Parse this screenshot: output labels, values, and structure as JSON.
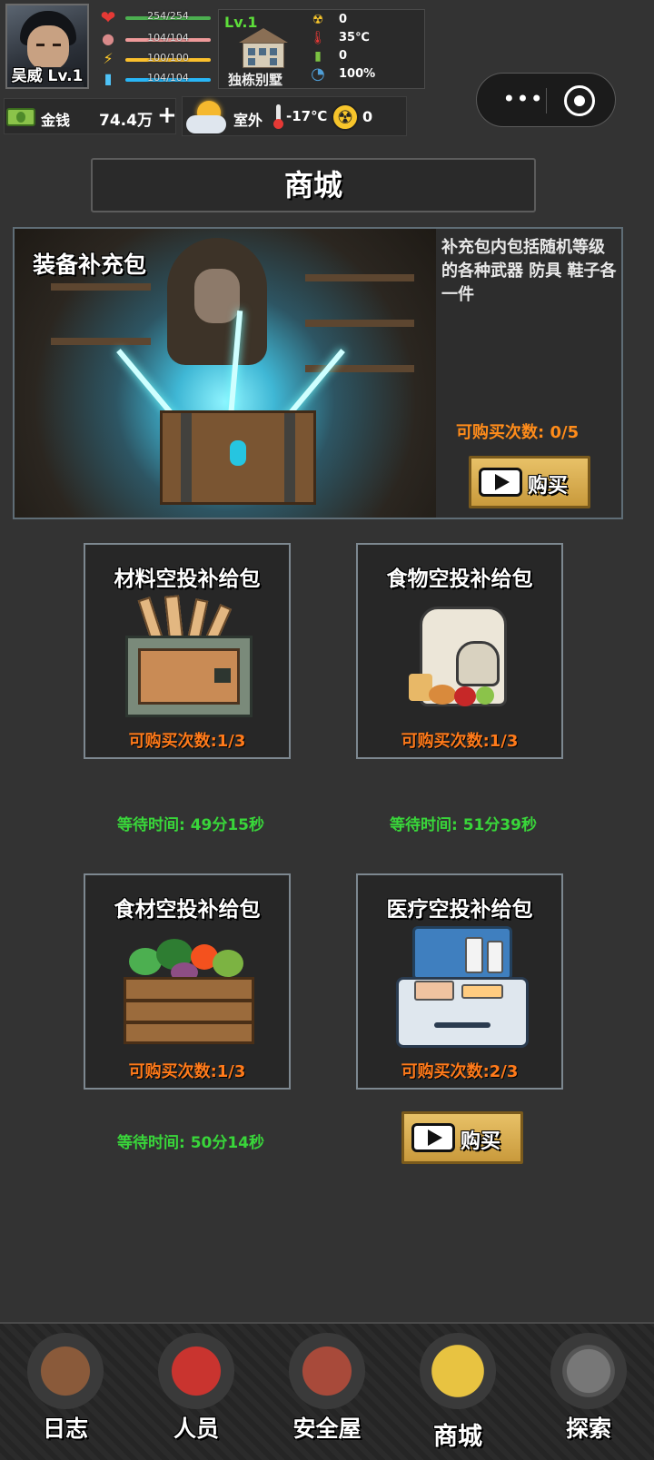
{
  "player": {
    "name_level": "吴威 Lv.1",
    "stats": [
      {
        "icon": "heart-icon",
        "glyph": "❤",
        "value": "254/254",
        "color": "#4caf50",
        "icon_color": "#e53935",
        "fill": 1.0
      },
      {
        "icon": "stomach-icon",
        "glyph": "●",
        "value": "104/104",
        "color": "#ef9a9a",
        "icon_color": "#d98a8a",
        "fill": 1.0
      },
      {
        "icon": "energy-icon",
        "glyph": "⚡",
        "value": "100/100",
        "color": "#fbc02d",
        "icon_color": "#ffca28",
        "fill": 1.0
      },
      {
        "icon": "water-icon",
        "glyph": "▮",
        "value": "104/104",
        "color": "#29b6f6",
        "icon_color": "#4fc3f7",
        "fill": 1.0
      }
    ]
  },
  "shelter": {
    "level": "Lv.1",
    "name": "独栋别墅",
    "stats": [
      {
        "icon": "radiation-icon",
        "glyph": "☢",
        "value": "0",
        "icon_color": "#f7c52b"
      },
      {
        "icon": "thermometer-icon",
        "glyph": "🌡",
        "value": "35℃",
        "icon_color": "#e53935"
      },
      {
        "icon": "battery-icon",
        "glyph": "▮",
        "value": "0",
        "icon_color": "#7cc242"
      },
      {
        "icon": "pie-chart-icon",
        "glyph": "◔",
        "value": "100%",
        "icon_color": "#4f9ed6"
      }
    ]
  },
  "money": {
    "label": "金钱",
    "value": "74.4万",
    "plus": "+"
  },
  "weather": {
    "label": "室外",
    "temperature": "-17℃",
    "radiation": "0"
  },
  "capsule": {
    "more": "•••"
  },
  "page_title": "商城",
  "equipment_pack": {
    "title": "装备补充包",
    "description": "补充包内包括随机等级的各种武器 防具 鞋子各一件",
    "purchase_count": "可购买次数: 0/5",
    "buy_label": "购买"
  },
  "supply_packs": [
    {
      "title": "材料空投补给包",
      "purchase_count": "可购买次数:1/3",
      "wait": "等待时间: 49分15秒"
    },
    {
      "title": "食物空投补给包",
      "purchase_count": "可购买次数:1/3",
      "wait": "等待时间: 51分39秒"
    },
    {
      "title": "食材空投补给包",
      "purchase_count": "可购买次数:1/3",
      "wait": "等待时间: 50分14秒"
    },
    {
      "title": "医疗空投补给包",
      "purchase_count": "可购买次数:2/3",
      "buy_label": "购买"
    }
  ],
  "nav": [
    {
      "label": "日志",
      "icon": "journal-icon"
    },
    {
      "label": "人员",
      "icon": "id-badge-icon"
    },
    {
      "label": "安全屋",
      "icon": "shelter-house-icon"
    },
    {
      "label": "商城",
      "icon": "shopping-basket-icon",
      "active": true
    },
    {
      "label": "探索",
      "icon": "compass-icon"
    }
  ]
}
